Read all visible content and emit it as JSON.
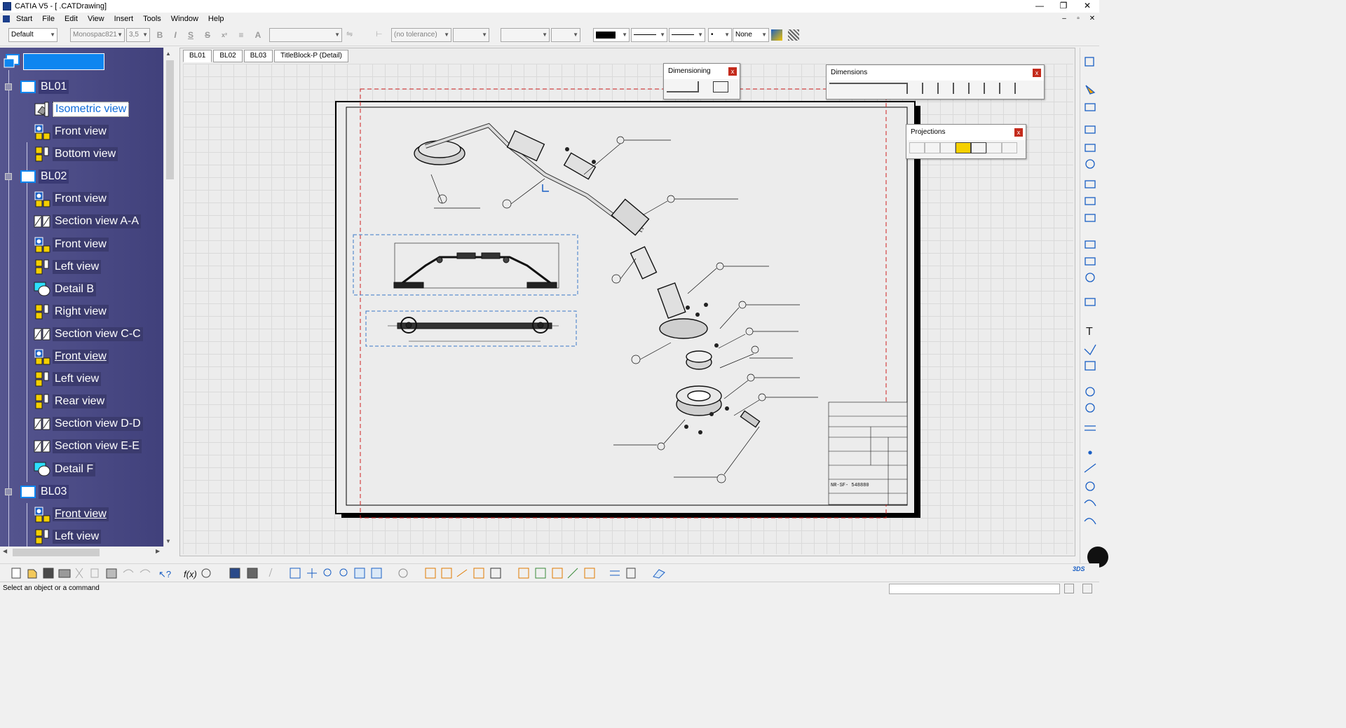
{
  "window": {
    "title": "CATIA V5 - [                    .CATDrawing]",
    "controls": [
      "—",
      "❐",
      "✕"
    ],
    "mdi_controls": [
      "–",
      "▫",
      "✕"
    ]
  },
  "menu": [
    "Start",
    "File",
    "Edit",
    "View",
    "Insert",
    "Tools",
    "Window",
    "Help"
  ],
  "format_toolbar": {
    "style": "Default",
    "font": "Monospac821",
    "font_size": "3,5",
    "tolerance": "(no tolerance)",
    "line_type": "None"
  },
  "tree": {
    "root_label": "",
    "sheets": [
      {
        "label": "BL01",
        "views": [
          {
            "label": "Isometric view",
            "icon": "isometric-view-icon",
            "selected": true
          },
          {
            "label": "Front view",
            "icon": "front-view-icon"
          },
          {
            "label": "Bottom view",
            "icon": "projection-view-icon"
          }
        ]
      },
      {
        "label": "BL02",
        "views": [
          {
            "label": "Front view",
            "icon": "front-view-icon"
          },
          {
            "label": "Section view A-A",
            "icon": "section-view-icon"
          },
          {
            "label": "Front view",
            "icon": "front-view-icon"
          },
          {
            "label": "Left view",
            "icon": "projection-view-icon"
          },
          {
            "label": "Detail B",
            "icon": "detail-view-icon"
          },
          {
            "label": "Right view",
            "icon": "projection-view-icon"
          },
          {
            "label": "Section view C-C",
            "icon": "section-view-icon"
          },
          {
            "label": "Front view",
            "icon": "front-view-icon",
            "underline": true
          },
          {
            "label": "Left view",
            "icon": "projection-view-icon"
          },
          {
            "label": "Rear view",
            "icon": "projection-view-icon"
          },
          {
            "label": "Section view D-D",
            "icon": "section-view-icon"
          },
          {
            "label": "Section view E-E",
            "icon": "section-view-icon"
          },
          {
            "label": "Detail F",
            "icon": "detail-view-icon"
          }
        ]
      },
      {
        "label": "BL03",
        "views": [
          {
            "label": "Front view",
            "icon": "front-view-icon",
            "underline": true
          },
          {
            "label": "Left view",
            "icon": "projection-view-icon"
          }
        ]
      }
    ]
  },
  "tabs": [
    "BL01",
    "BL02",
    "BL03",
    "TitleBlock-P (Detail)"
  ],
  "active_tab": "BL01",
  "floating_toolbars": {
    "dimensioning": "Dimensioning",
    "dimensions": "Dimensions",
    "projections": "Projections",
    "close": "x"
  },
  "drawing": {
    "part_number": "NR-SF- 548880"
  },
  "status_text": "Select an object or a command",
  "colors": {
    "tree_bg": "#45457f",
    "accent": "#0e86f0",
    "sheet_border": "#000000",
    "print_area": "#d02020",
    "view_frame": "#3a78c8"
  }
}
